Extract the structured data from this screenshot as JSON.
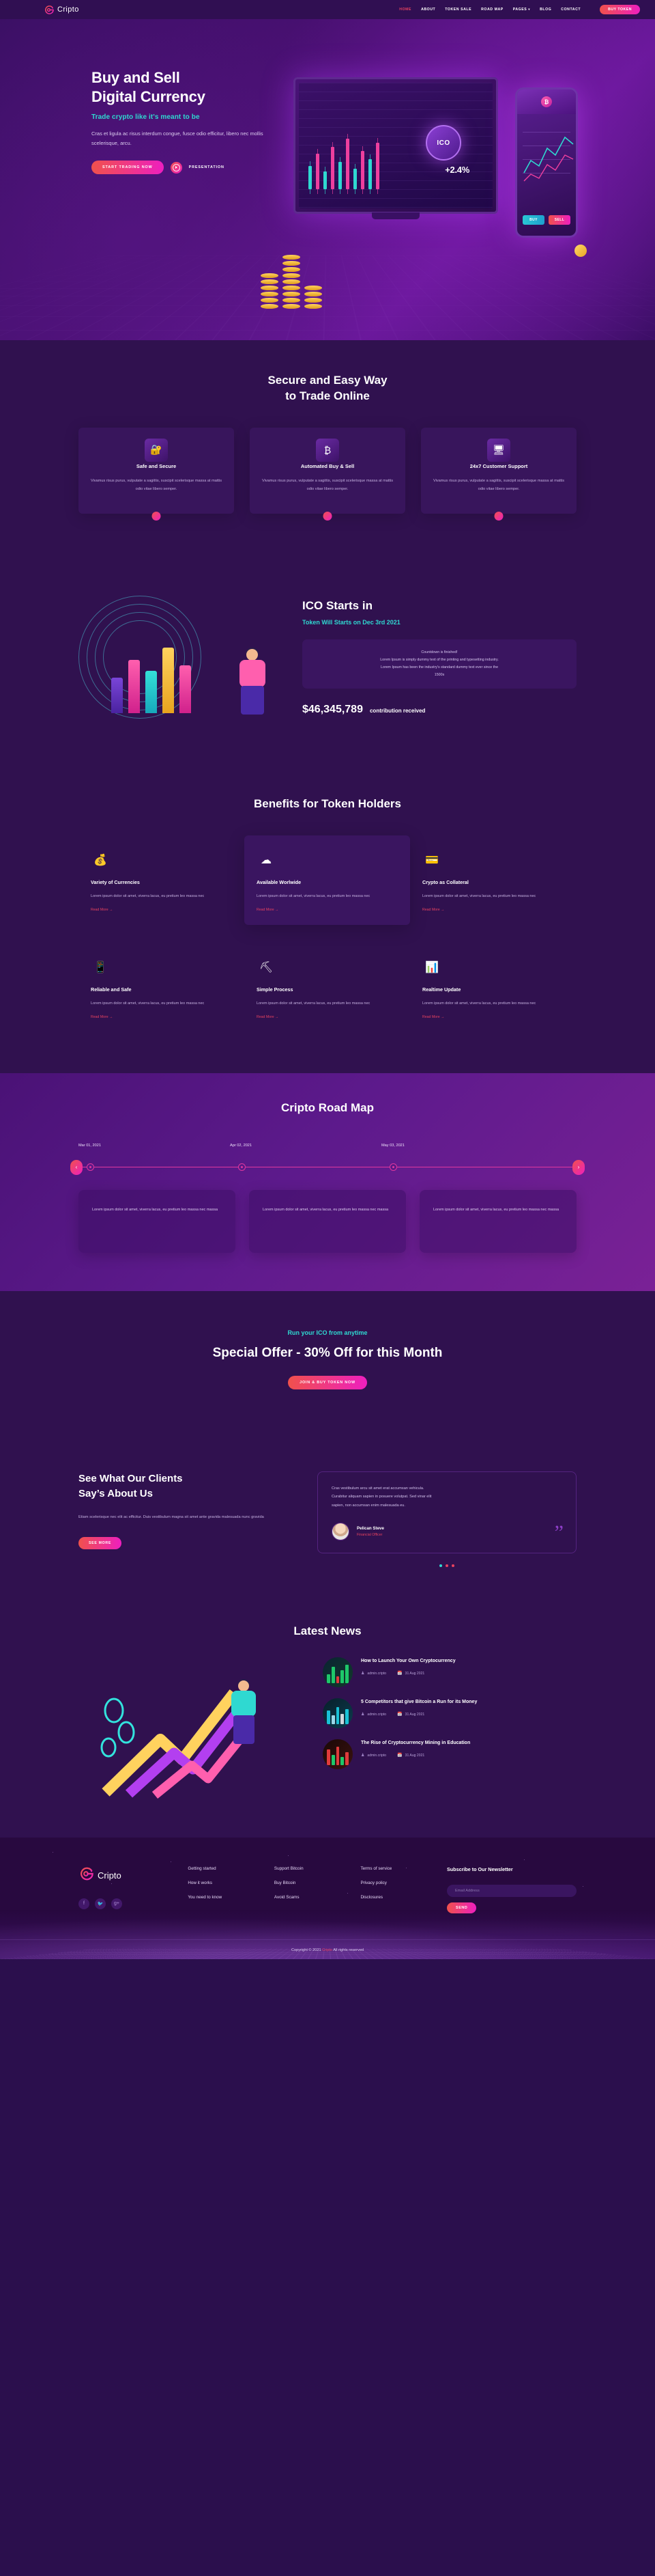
{
  "brand": {
    "name": "Cripto",
    "logo_icon": "cripto-spiral-logo"
  },
  "nav": {
    "items": [
      {
        "label": "HOME",
        "active": true
      },
      {
        "label": "ABOUT",
        "active": false
      },
      {
        "label": "TOKEN SALE",
        "active": false
      },
      {
        "label": "ROAD MAP",
        "active": false
      },
      {
        "label": "PAGES",
        "active": false,
        "has_dropdown": true
      },
      {
        "label": "BLOG",
        "active": false
      },
      {
        "label": "CONTACT",
        "active": false
      }
    ],
    "cta": "BUY TOKEN"
  },
  "hero": {
    "title_line1": "Buy and Sell",
    "title_line2": "Digital Currency",
    "subtitle": "Trade crypto like it's meant to be",
    "paragraph": "Cras et ligula ac risus interdum congue, fusce odio efficitur, libero nec mollis scelerisque, arcu.",
    "primary_cta": "START TRADING NOW",
    "secondary_cta": "PRESENTATION",
    "artwork": {
      "ico_badge": "ICO",
      "percent_change": "+2.4%",
      "phone_coin": "₿",
      "phone_buy": "BUY",
      "phone_sell": "SELL"
    }
  },
  "features": {
    "title_line1": "Secure and Easy Way",
    "title_line2": "to Trade Online",
    "cards": [
      {
        "icon": "lock-shield-icon",
        "glyph": "🔐",
        "title": "Safe and Secure",
        "text": "Vivamus risus purus, vulputate a sagittis, suscipit scelerisque massa at mattis odio vitae libero semper."
      },
      {
        "icon": "bitcoin-exchange-icon",
        "glyph": "₿",
        "title": "Automated Buy & Sell",
        "text": "Vivamus risus purus, vulputate a sagittis, suscipit scelerisque massa at mattis odio vitae libero semper."
      },
      {
        "icon": "support-screen-icon",
        "glyph": "🖥",
        "title": "24x7 Customer Support",
        "text": "Vivamus risus purus, vulputate a sagittis, suscipit scelerisque massa at mattis odio vitae libero semper."
      }
    ]
  },
  "ico": {
    "heading": "ICO Starts in",
    "subheading": "Token Will Starts on Dec 3rd 2021",
    "countdown_lines": [
      "Countdown is finished!",
      "Lorem Ipsum is simply dummy text of the printing and typesetting industry.",
      "Lorem Ipsum has been the industry's standard dummy text ever since the",
      "1500s"
    ],
    "amount": "$46,345,789",
    "amount_label": "contribution received"
  },
  "benefits": {
    "title": "Benefits for Token Holders",
    "read_more": "Read More →",
    "cards": [
      {
        "icon": "money-bag-icon",
        "glyph": "💰",
        "title": "Variety of Currencies",
        "text": "Lorem ipsum dolor sit amet, viverra lacus, eu pretium leo massa nec",
        "highlight": false
      },
      {
        "icon": "cloud-network-icon",
        "glyph": "☁",
        "title": "Available Worlwide",
        "text": "Lorem ipsum dolor sit amet, viverra lacus, eu pretium leo massa nec",
        "highlight": true
      },
      {
        "icon": "crypto-card-icon",
        "glyph": "💳",
        "title": "Crypto as Collateral",
        "text": "Lorem ipsum dolor sit amet, viverra lacus, eu pretium leo massa nec",
        "highlight": false
      },
      {
        "icon": "secure-wallet-icon",
        "glyph": "📱",
        "title": "Reliable and Safe",
        "text": "Lorem ipsum dolor sit amet, viverra lacus, eu pretium leo massa nec",
        "highlight": false
      },
      {
        "icon": "mining-pickaxe-icon",
        "glyph": "⛏",
        "title": "Simple Process",
        "text": "Lorem ipsum dolor sit amet, viverra lacus, eu pretium leo massa nec",
        "highlight": false
      },
      {
        "icon": "realtime-chart-icon",
        "glyph": "📊",
        "title": "Realtime Update",
        "text": "Lorem ipsum dolor sit amet, viverra lacus, eu pretium leo massa nec",
        "highlight": false
      }
    ]
  },
  "roadmap": {
    "title": "Cripto Road Map",
    "prev_icon": "chevron-left-icon",
    "next_icon": "chevron-right-icon",
    "milestones": [
      {
        "date": "Mar 01, 2021",
        "text": "Lorem ipsum dolor sit amet, viverra lacus, eu pretium leo massa nec massa"
      },
      {
        "date": "Apr 02, 2021",
        "text": "Lorem ipsum dolor sit amet, viverra lacus, eu pretium leo massa nec massa"
      },
      {
        "date": "May 03, 2021",
        "text": "Lorem ipsum dolor sit amet, viverra lacus, eu pretium leo massa nec massa"
      }
    ]
  },
  "offer": {
    "eyebrow": "Run your ICO from anytime",
    "headline": "Special Offer - 30% Off for this Month",
    "cta": "JOIN & BUY TOKEN NOW"
  },
  "testimonials": {
    "heading_line1": "See What Our Clients",
    "heading_line2": "Say’s About Us",
    "paragraph": "Etiam scelerisque nec elit ac efficitur. Duis vestibulum magna sit amet ante gravida malesuada nunc gravida",
    "cta": "SEE MORE",
    "quote_lines": [
      "Cras vestibulum arcu sit amet erat accumsan vehicula.",
      "Curabitur aliquam sapien in posuere volutpat. Sed vinar elit",
      "sapien, non accumsan enim malesuada eu."
    ],
    "author_name": "Pelican Steve",
    "author_role": "Financial Officer",
    "quote_icon": "quotation-mark-icon",
    "active_dot": 0,
    "dot_count": 3
  },
  "news": {
    "title": "Latest News",
    "author_icon": "user-icon",
    "date_icon": "calendar-icon",
    "items": [
      {
        "title": "How to Launch Your Own Cryptocurrency",
        "author": "admin.cripto",
        "date": "31 Aug 2021"
      },
      {
        "title": "5 Competitors that give Bitcoin a Run for its Money",
        "author": "admin.cripto",
        "date": "31 Aug 2021"
      },
      {
        "title": "The Rise of Cryptocurrency Mining in Education",
        "author": "admin.cripto",
        "date": "31 Aug 2021"
      }
    ]
  },
  "footer": {
    "brand": "Cripto",
    "socials": [
      {
        "name": "facebook-icon",
        "glyph": "f"
      },
      {
        "name": "twitter-icon",
        "glyph": "🐦"
      },
      {
        "name": "google-plus-icon",
        "glyph": "g+"
      }
    ],
    "columns": [
      {
        "links": [
          "Getting started",
          "How it works",
          "You need to know"
        ]
      },
      {
        "links": [
          "Support Bitcoin",
          "Buy Bitcoin",
          "Avoid Scams"
        ]
      },
      {
        "links": [
          "Terms of service",
          "Privacy policy",
          "Disclosures"
        ]
      }
    ],
    "newsletter": {
      "heading": "Subscribe to Our Newsletter",
      "placeholder": "Email Address",
      "value": "",
      "button": "SEND"
    },
    "copyright_pre": "Copyright © 2021 ",
    "copyright_brand": "Cripto",
    "copyright_post": " All rights reserved"
  },
  "colors": {
    "bg": "#30114f",
    "accent_pink": "#ee1fbf",
    "accent_red": "#f0514c",
    "teal": "#2fd9d1",
    "card": "#38155c"
  }
}
